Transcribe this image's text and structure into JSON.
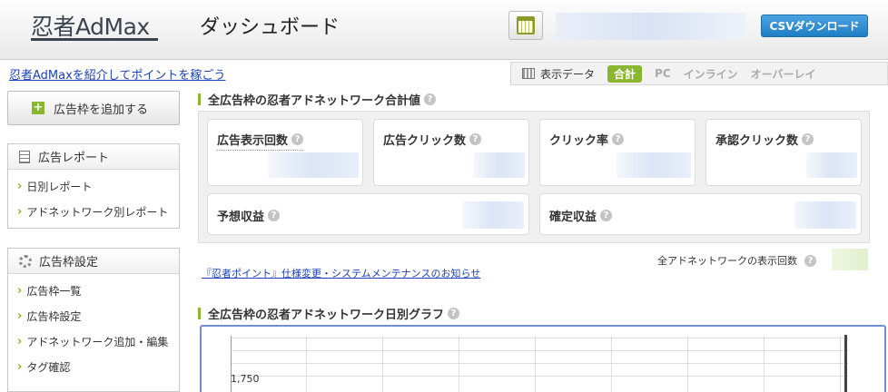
{
  "header": {
    "logo": "忍者AdMax",
    "page_title": "ダッシュボード",
    "csv_button": "CSVダウンロード"
  },
  "promo_link": "忍者AdMaxを紹介してポイントを稼ごう",
  "view_toggle": {
    "label": "表示データ",
    "tabs": [
      "合計",
      "PC",
      "インライン",
      "オーバーレイ"
    ],
    "active": "合計"
  },
  "sidebar": {
    "add_button": "広告枠を追加する",
    "report": {
      "title": "広告レポート",
      "items": [
        "日別レポート",
        "アドネットワーク別レポート"
      ]
    },
    "settings": {
      "title": "広告枠設定",
      "items": [
        "広告枠一覧",
        "広告枠設定",
        "アドネットワーク追加・編集",
        "タグ確認"
      ]
    }
  },
  "summary": {
    "title": "全広告枠の忍者アドネットワーク合計値",
    "stats": {
      "impressions": "広告表示回数",
      "clicks": "広告クリック数",
      "ctr": "クリック率",
      "approved_clicks": "承認クリック数",
      "expected_revenue": "予想収益",
      "confirmed_revenue": "確定収益"
    }
  },
  "all_network_impressions_label": "全アドネットワークの表示回数",
  "notice_link": "『忍者ポイント』仕様変更・システムメンテナンスのお知らせ",
  "graph": {
    "title": "全広告枠の忍者アドネットワーク日別グラフ",
    "y_tick": "1,750"
  },
  "colors": {
    "accent_green": "#8bb62f",
    "csv_blue": "#1f7ec4",
    "link_blue": "#1a3fbf"
  }
}
